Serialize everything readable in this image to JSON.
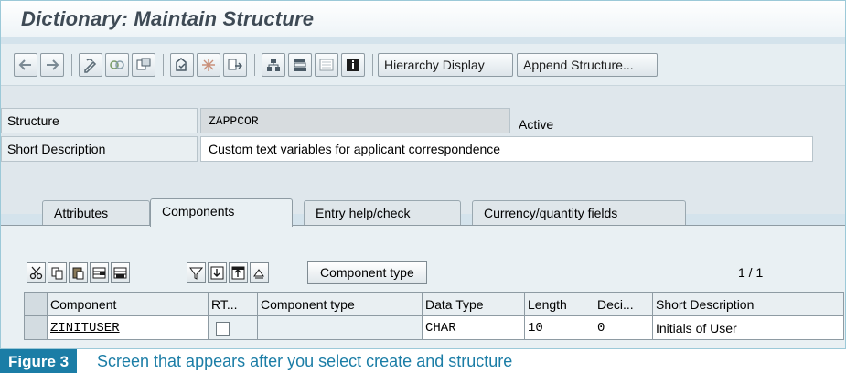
{
  "window": {
    "title": "Dictionary: Maintain Structure"
  },
  "toolbar": {
    "icons": [
      "back-icon",
      "forward-icon",
      "change-display-icon",
      "active-inactive-icon",
      "other-object-icon",
      "check-icon",
      "activate-icon",
      "where-used-icon",
      "object-list-icon",
      "navigation-window-icon",
      "display-object-list-icon",
      "information-icon"
    ],
    "hierarchy_display": "Hierarchy Display",
    "append_structure": "Append Structure..."
  },
  "fields": {
    "structure_label": "Structure",
    "structure_value": "ZAPPCOR",
    "structure_status": "Active",
    "short_desc_label": "Short Description",
    "short_desc_value": "Custom text variables for applicant correspondence"
  },
  "tabs": [
    {
      "label": "Attributes"
    },
    {
      "label": "Components",
      "active": true
    },
    {
      "label": "Entry help/check"
    },
    {
      "label": "Currency/quantity fields"
    }
  ],
  "panel_toolbar": {
    "component_type_button": "Component type",
    "page_indicator": "1  /  1"
  },
  "table": {
    "headers": [
      "Component",
      "RT...",
      "Component type",
      "Data Type",
      "Length",
      "Deci...",
      "Short Description"
    ],
    "rows": [
      {
        "component": "ZINITUSER",
        "rt": false,
        "component_type": "",
        "data_type": "CHAR",
        "length": "10",
        "decimals": "0",
        "short_description": "Initials of User"
      }
    ]
  },
  "caption": {
    "label": "Figure 3",
    "text": "Screen that appears after you select create and structure"
  },
  "colors": {
    "caption_accent": "#1b7da6",
    "title_text": "#3e4a55"
  }
}
